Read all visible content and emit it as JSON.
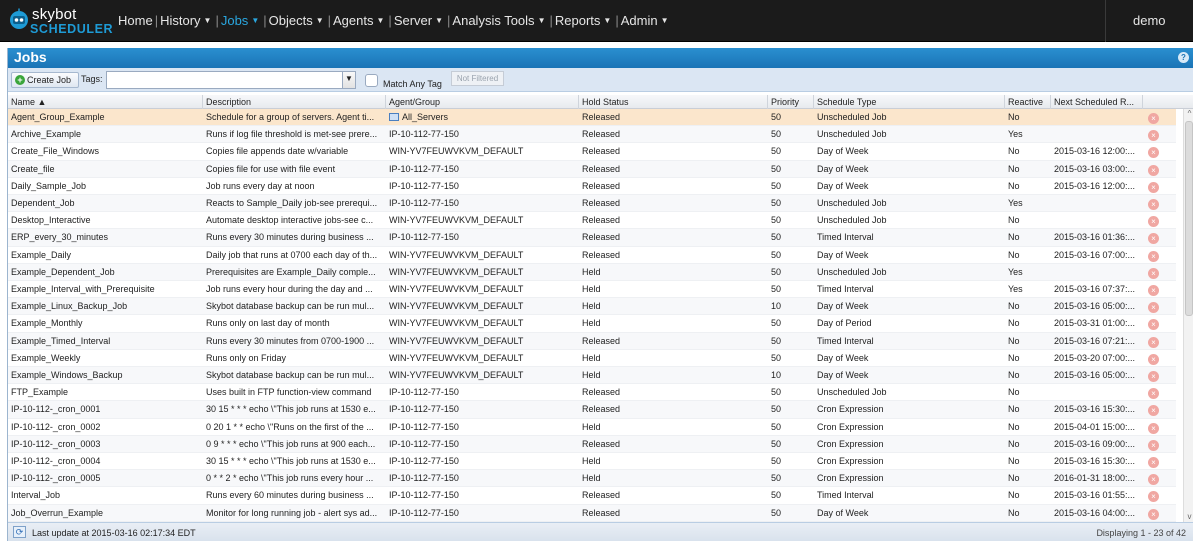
{
  "app": {
    "logo_top": "skybot",
    "logo_bottom": "SCHEDULER",
    "user": "demo",
    "nav": [
      {
        "label": "Home",
        "caret": false,
        "active": false
      },
      {
        "label": "History",
        "caret": true,
        "active": false
      },
      {
        "label": "Jobs",
        "caret": true,
        "active": true
      },
      {
        "label": "Objects",
        "caret": true,
        "active": false
      },
      {
        "label": "Agents",
        "caret": true,
        "active": false
      },
      {
        "label": "Server",
        "caret": true,
        "active": false
      },
      {
        "label": "Analysis Tools",
        "caret": true,
        "active": false
      },
      {
        "label": "Reports",
        "caret": true,
        "active": false
      },
      {
        "label": "Admin",
        "caret": true,
        "active": false
      }
    ]
  },
  "panel": {
    "title": "Jobs",
    "toolbar": {
      "create_job": "Create Job",
      "tags_label": "Tags:",
      "tags_value": "",
      "match_any_tag": "Match Any Tag",
      "not_filtered": "Not Filtered"
    },
    "columns": [
      {
        "key": "name",
        "label": "Name ▲"
      },
      {
        "key": "description",
        "label": "Description"
      },
      {
        "key": "agent",
        "label": "Agent/Group"
      },
      {
        "key": "hold",
        "label": "Hold Status"
      },
      {
        "key": "priority",
        "label": "Priority"
      },
      {
        "key": "schedule",
        "label": "Schedule Type"
      },
      {
        "key": "reactive",
        "label": "Reactive"
      },
      {
        "key": "next",
        "label": "Next Scheduled R..."
      }
    ],
    "rows": [
      {
        "name": "Agent_Group_Example",
        "description": "Schedule for a group of servers. Agent ti...",
        "agent": "All_Servers",
        "group": true,
        "hold": "Released",
        "priority": "50",
        "schedule": "Unscheduled Job",
        "reactive": "No",
        "next": ""
      },
      {
        "name": "Archive_Example",
        "description": "Runs if log file threshold is met-see prere...",
        "agent": "IP-10-112-77-150",
        "group": false,
        "hold": "Released",
        "priority": "50",
        "schedule": "Unscheduled Job",
        "reactive": "Yes",
        "next": ""
      },
      {
        "name": "Create_File_Windows",
        "description": "Copies file appends date w/variable",
        "agent": "WIN-YV7FEUWVKVM_DEFAULT",
        "group": false,
        "hold": "Released",
        "priority": "50",
        "schedule": "Day of Week",
        "reactive": "No",
        "next": "2015-03-16 12:00:..."
      },
      {
        "name": "Create_file",
        "description": "Copies file for use with file event",
        "agent": "IP-10-112-77-150",
        "group": false,
        "hold": "Released",
        "priority": "50",
        "schedule": "Day of Week",
        "reactive": "No",
        "next": "2015-03-16 03:00:..."
      },
      {
        "name": "Daily_Sample_Job",
        "description": "Job runs every day at noon",
        "agent": "IP-10-112-77-150",
        "group": false,
        "hold": "Released",
        "priority": "50",
        "schedule": "Day of Week",
        "reactive": "No",
        "next": "2015-03-16 12:00:..."
      },
      {
        "name": "Dependent_Job",
        "description": "Reacts to Sample_Daily job-see prerequi...",
        "agent": "IP-10-112-77-150",
        "group": false,
        "hold": "Released",
        "priority": "50",
        "schedule": "Unscheduled Job",
        "reactive": "Yes",
        "next": ""
      },
      {
        "name": "Desktop_Interactive",
        "description": "Automate desktop interactive jobs-see c...",
        "agent": "WIN-YV7FEUWVKVM_DEFAULT",
        "group": false,
        "hold": "Released",
        "priority": "50",
        "schedule": "Unscheduled Job",
        "reactive": "No",
        "next": ""
      },
      {
        "name": "ERP_every_30_minutes",
        "description": "Runs every 30 minutes during business ...",
        "agent": "IP-10-112-77-150",
        "group": false,
        "hold": "Released",
        "priority": "50",
        "schedule": "Timed Interval",
        "reactive": "No",
        "next": "2015-03-16 01:36:..."
      },
      {
        "name": "Example_Daily",
        "description": "Daily job that runs at 0700 each day of th...",
        "agent": "WIN-YV7FEUWVKVM_DEFAULT",
        "group": false,
        "hold": "Released",
        "priority": "50",
        "schedule": "Day of Week",
        "reactive": "No",
        "next": "2015-03-16 07:00:..."
      },
      {
        "name": "Example_Dependent_Job",
        "description": "Prerequisites are Example_Daily comple...",
        "agent": "WIN-YV7FEUWVKVM_DEFAULT",
        "group": false,
        "hold": "Held",
        "priority": "50",
        "schedule": "Unscheduled Job",
        "reactive": "Yes",
        "next": ""
      },
      {
        "name": "Example_Interval_with_Prerequisite",
        "description": "Job runs every hour during the day and ...",
        "agent": "WIN-YV7FEUWVKVM_DEFAULT",
        "group": false,
        "hold": "Held",
        "priority": "50",
        "schedule": "Timed Interval",
        "reactive": "Yes",
        "next": "2015-03-16 07:37:..."
      },
      {
        "name": "Example_Linux_Backup_Job",
        "description": "Skybot database backup can be run mul...",
        "agent": "WIN-YV7FEUWVKVM_DEFAULT",
        "group": false,
        "hold": "Held",
        "priority": "10",
        "schedule": "Day of Week",
        "reactive": "No",
        "next": "2015-03-16 05:00:..."
      },
      {
        "name": "Example_Monthly",
        "description": "Runs only on last day of month",
        "agent": "WIN-YV7FEUWVKVM_DEFAULT",
        "group": false,
        "hold": "Held",
        "priority": "50",
        "schedule": "Day of Period",
        "reactive": "No",
        "next": "2015-03-31 01:00:..."
      },
      {
        "name": "Example_Timed_Interval",
        "description": "Runs every 30 minutes from 0700-1900 ...",
        "agent": "WIN-YV7FEUWVKVM_DEFAULT",
        "group": false,
        "hold": "Released",
        "priority": "50",
        "schedule": "Timed Interval",
        "reactive": "No",
        "next": "2015-03-16 07:21:..."
      },
      {
        "name": "Example_Weekly",
        "description": "Runs only on Friday",
        "agent": "WIN-YV7FEUWVKVM_DEFAULT",
        "group": false,
        "hold": "Held",
        "priority": "50",
        "schedule": "Day of Week",
        "reactive": "No",
        "next": "2015-03-20 07:00:..."
      },
      {
        "name": "Example_Windows_Backup",
        "description": "Skybot database backup can be run mul...",
        "agent": "WIN-YV7FEUWVKVM_DEFAULT",
        "group": false,
        "hold": "Held",
        "priority": "10",
        "schedule": "Day of Week",
        "reactive": "No",
        "next": "2015-03-16 05:00:..."
      },
      {
        "name": "FTP_Example",
        "description": "Uses built in FTP function-view command",
        "agent": "IP-10-112-77-150",
        "group": false,
        "hold": "Released",
        "priority": "50",
        "schedule": "Unscheduled Job",
        "reactive": "No",
        "next": ""
      },
      {
        "name": "IP-10-112-_cron_0001",
        "description": "30 15 * * * echo \\\"This job runs at 1530 e...",
        "agent": "IP-10-112-77-150",
        "group": false,
        "hold": "Released",
        "priority": "50",
        "schedule": "Cron Expression",
        "reactive": "No",
        "next": "2015-03-16 15:30:..."
      },
      {
        "name": "IP-10-112-_cron_0002",
        "description": "0 20 1 * * echo \\\"Runs on the first of the ...",
        "agent": "IP-10-112-77-150",
        "group": false,
        "hold": "Held",
        "priority": "50",
        "schedule": "Cron Expression",
        "reactive": "No",
        "next": "2015-04-01 15:00:..."
      },
      {
        "name": "IP-10-112-_cron_0003",
        "description": "0 9 * * * echo \\\"This job runs at 900 each...",
        "agent": "IP-10-112-77-150",
        "group": false,
        "hold": "Released",
        "priority": "50",
        "schedule": "Cron Expression",
        "reactive": "No",
        "next": "2015-03-16 09:00:..."
      },
      {
        "name": "IP-10-112-_cron_0004",
        "description": "30 15 * * * echo \\\"This job runs at 1530 e...",
        "agent": "IP-10-112-77-150",
        "group": false,
        "hold": "Held",
        "priority": "50",
        "schedule": "Cron Expression",
        "reactive": "No",
        "next": "2015-03-16 15:30:..."
      },
      {
        "name": "IP-10-112-_cron_0005",
        "description": "0 * * 2 * echo \\\"This job runs every hour ...",
        "agent": "IP-10-112-77-150",
        "group": false,
        "hold": "Held",
        "priority": "50",
        "schedule": "Cron Expression",
        "reactive": "No",
        "next": "2016-01-31 18:00:..."
      },
      {
        "name": "Interval_Job",
        "description": "Runs every 60 minutes during business ...",
        "agent": "IP-10-112-77-150",
        "group": false,
        "hold": "Released",
        "priority": "50",
        "schedule": "Timed Interval",
        "reactive": "No",
        "next": "2015-03-16 01:55:..."
      },
      {
        "name": "Job_Overrun_Example",
        "description": "Monitor for long running job - alert sys ad...",
        "agent": "IP-10-112-77-150",
        "group": false,
        "hold": "Released",
        "priority": "50",
        "schedule": "Day of Week",
        "reactive": "No",
        "next": "2015-03-16 04:00:..."
      }
    ],
    "status": {
      "last_update": "Last update at 2015-03-16 02:17:34 EDT",
      "displaying": "Displaying 1 - 23 of 42"
    }
  }
}
